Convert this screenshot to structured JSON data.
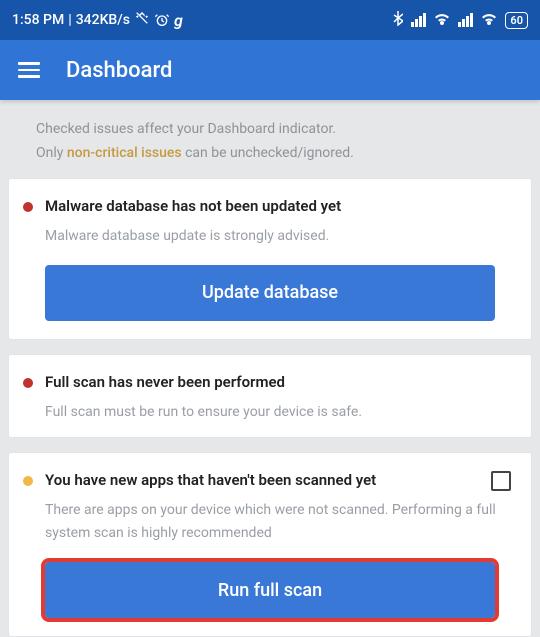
{
  "statusBar": {
    "time": "1:58 PM",
    "speed": "342KB/s",
    "rightGlyph": "g",
    "batteryLevel": "60"
  },
  "appBar": {
    "title": "Dashboard"
  },
  "info": {
    "line1": "Checked issues affect your Dashboard indicator.",
    "line2a": "Only ",
    "nonCritical": "non-critical issues",
    "line2b": " can be unchecked/ignored."
  },
  "issues": [
    {
      "title": "Malware database has not been updated yet",
      "desc": "Malware database update is strongly advised.",
      "buttonLabel": "Update database"
    },
    {
      "title": "Full scan has never been performed",
      "desc": "Full scan must be run to ensure your device is safe."
    },
    {
      "title": "You have new apps that haven't been scanned yet",
      "desc": "There are apps on your device which were not scanned. Performing a full system scan is highly recommended",
      "buttonLabel": "Run full scan"
    }
  ]
}
